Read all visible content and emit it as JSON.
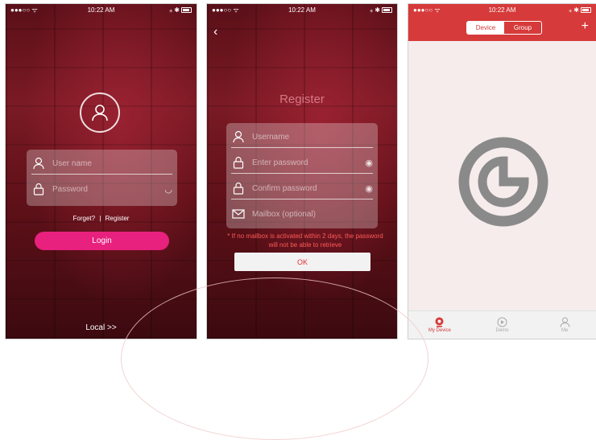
{
  "statusbar": {
    "time": "10:22 AM"
  },
  "login": {
    "username_placeholder": "User name",
    "password_placeholder": "Password",
    "forgot_label": "Forget?",
    "separator": "|",
    "register_label": "Register",
    "login_button": "Login",
    "local_label": "Local >>"
  },
  "register": {
    "title": "Register",
    "username_placeholder": "Username",
    "password_placeholder": "Enter password",
    "confirm_placeholder": "Confirm password",
    "email_placeholder": "Mailbox (optional)",
    "warning": "* If no mailbox is activated within 2 days, the password will not be able to retrieve",
    "ok_button": "OK"
  },
  "devices": {
    "tabs": [
      "Device",
      "Group"
    ],
    "active_tab": "Device",
    "bottom_tabs": [
      {
        "label": "My Device",
        "icon": "camera-icon",
        "active": true
      },
      {
        "label": "Demo",
        "icon": "play-icon",
        "active": false
      },
      {
        "label": "Me",
        "icon": "person-icon",
        "active": false
      }
    ]
  },
  "colors": {
    "accent_red": "#d63a3a",
    "login_pink": "#e8207e",
    "spinner_gray": "#8a8a8a"
  }
}
